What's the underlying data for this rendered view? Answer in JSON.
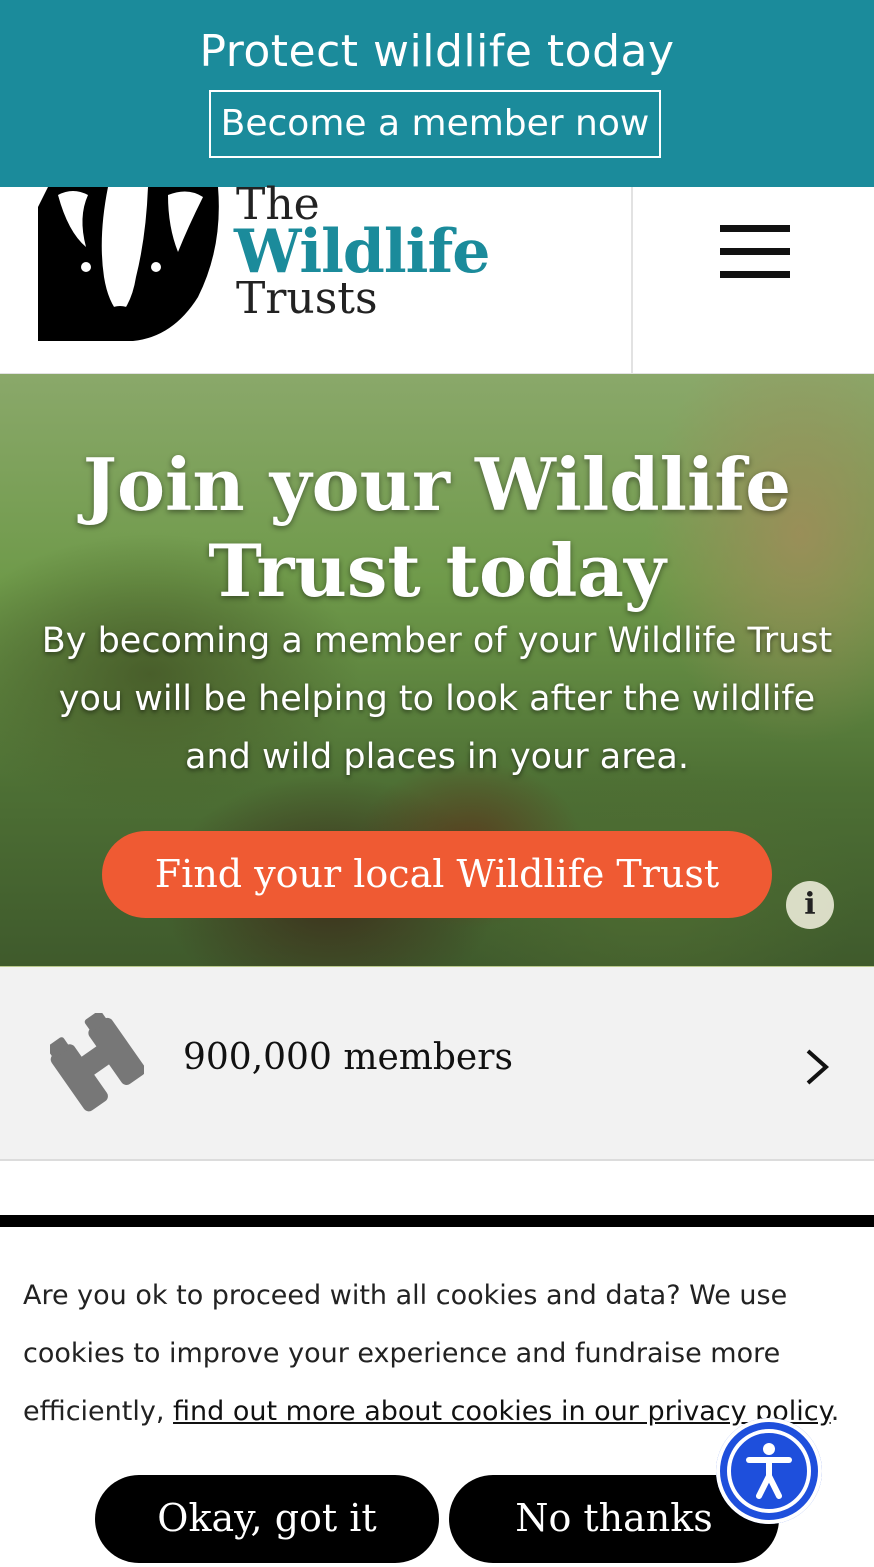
{
  "promo": {
    "title": "Protect wildlife today",
    "button_label": "Become a member now"
  },
  "header": {
    "logo": {
      "line1": "The",
      "line2": "Wildlife",
      "line3": "Trusts"
    },
    "menu_icon": "hamburger-icon"
  },
  "hero": {
    "title": "Join your Wildlife Trust today",
    "text": "By becoming a member of your Wildlife Trust you will be helping to look after the wildlife and wild places in your area.",
    "button_label": "Find your local Wildlife Trust",
    "info_label": "i"
  },
  "stats": {
    "label": "900,000 members",
    "icon": "binoculars-icon",
    "chevron_icon": "chevron-right-icon"
  },
  "cookie": {
    "text": "Are you ok to proceed with all cookies and data? We use cookies to improve your experience and fundraise more efficiently, ",
    "link": "find out more about cookies in our privacy policy",
    "text_end": ".",
    "ok_label": "Okay, got it",
    "no_label": "No thanks"
  },
  "accessibility": {
    "icon": "accessibility-icon"
  },
  "colors": {
    "brand_teal": "#1b8b9b",
    "cta_orange": "#ef5a33",
    "a11y_blue": "#1e4fdc"
  }
}
